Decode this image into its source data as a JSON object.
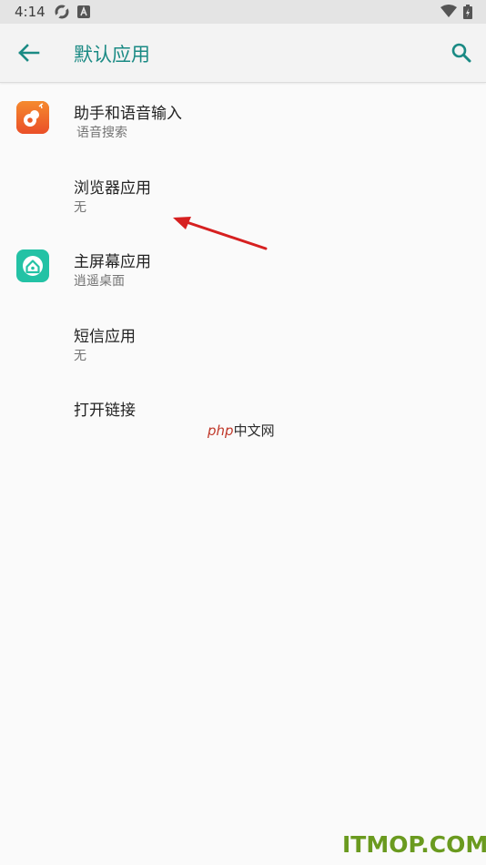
{
  "status_bar": {
    "time": "4:14"
  },
  "app_bar": {
    "title": "默认应用"
  },
  "items": [
    {
      "title": "助手和语音输入",
      "subtitle": "语音搜索"
    },
    {
      "title": "浏览器应用",
      "subtitle": "无"
    },
    {
      "title": "主屏幕应用",
      "subtitle": "逍遥桌面"
    },
    {
      "title": "短信应用",
      "subtitle": "无"
    },
    {
      "title": "打开链接",
      "subtitle": ""
    }
  ],
  "watermarks": {
    "php": "php",
    "php_cn": "中文网",
    "itmop": "ITMOP.COM"
  },
  "colors": {
    "accent": "#1a8a84",
    "arrow": "#d62020",
    "icon_orange": "#f26b2b",
    "icon_teal": "#23c2a5"
  }
}
